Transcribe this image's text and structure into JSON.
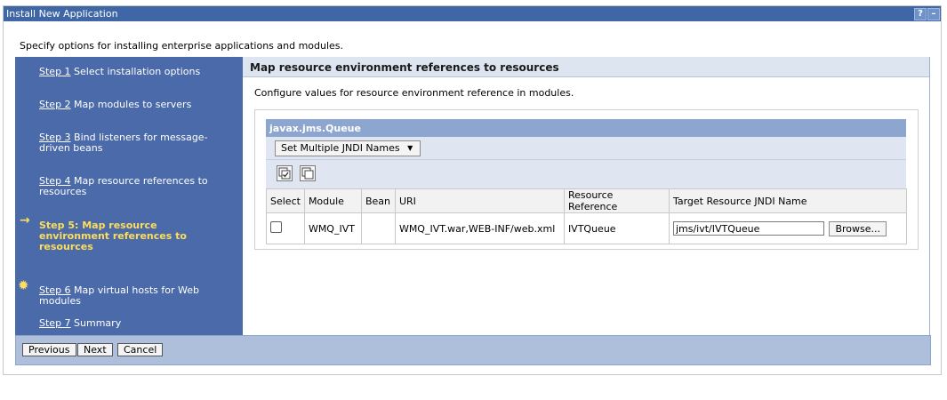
{
  "window": {
    "title": "Install New Application",
    "help_button": "?",
    "minimize_button": "–"
  },
  "instruction": "Specify options for installing enterprise applications and modules.",
  "steps": [
    {
      "link": "Step 1",
      "text": " Select installation options"
    },
    {
      "link": "Step 2",
      "text": " Map modules to servers"
    },
    {
      "link": "Step 3",
      "text": " Bind listeners for message-driven beans"
    },
    {
      "link": "Step 4",
      "text": " Map resource references to resources"
    },
    {
      "full": "Step 5: Map resource environment references to resources"
    },
    {
      "link": "Step 6",
      "text": " Map virtual hosts for Web modules"
    },
    {
      "link": "Step 7",
      "text": " Summary"
    }
  ],
  "main": {
    "header": "Map resource environment references to resources",
    "description": "Configure values for resource environment reference in modules.",
    "table_title": "javax.jms.Queue",
    "menu_button": "Set Multiple JNDI Names",
    "columns": [
      "Select",
      "Module",
      "Bean",
      "URI",
      "Resource Reference",
      "Target Resource JNDI Name"
    ],
    "rows": [
      {
        "module": "WMQ_IVT",
        "bean": "",
        "uri": "WMQ_IVT.war,WEB-INF/web.xml",
        "resource_reference": "IVTQueue",
        "jndi_value": "jms/ivt/IVTQueue",
        "browse": "Browse..."
      }
    ]
  },
  "footer": {
    "previous": "Previous",
    "next": "Next",
    "cancel": "Cancel"
  }
}
